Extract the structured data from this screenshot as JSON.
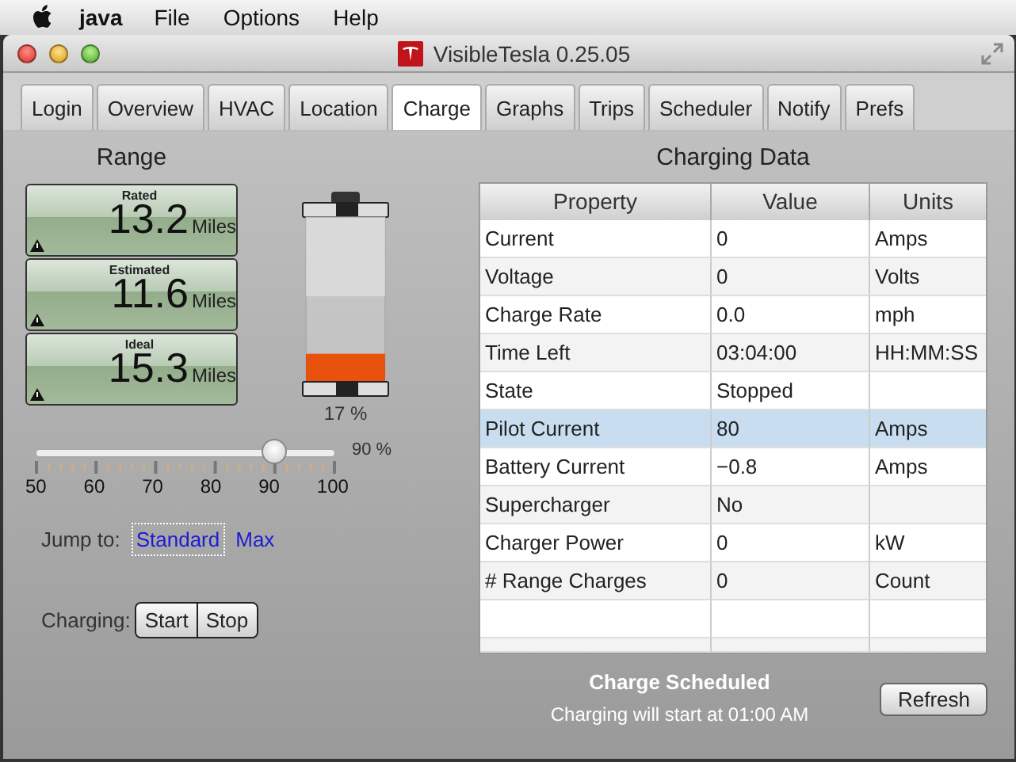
{
  "menubar": {
    "app": "java",
    "items": [
      "File",
      "Options",
      "Help"
    ]
  },
  "window": {
    "title": "VisibleTesla 0.25.05"
  },
  "tabs": [
    {
      "label": "Login",
      "selected": false
    },
    {
      "label": "Overview",
      "selected": false
    },
    {
      "label": "HVAC",
      "selected": false
    },
    {
      "label": "Location",
      "selected": false
    },
    {
      "label": "Charge",
      "selected": true
    },
    {
      "label": "Graphs",
      "selected": false
    },
    {
      "label": "Trips",
      "selected": false
    },
    {
      "label": "Scheduler",
      "selected": false
    },
    {
      "label": "Notify",
      "selected": false
    },
    {
      "label": "Prefs",
      "selected": false
    }
  ],
  "range": {
    "title": "Range",
    "gauges": [
      {
        "label": "Rated",
        "value": "13.2",
        "unit": "Miles",
        "warning": true
      },
      {
        "label": "Estimated",
        "value": "11.6",
        "unit": "Miles",
        "warning": true
      },
      {
        "label": "Ideal",
        "value": "15.3",
        "unit": "Miles",
        "warning": true
      }
    ]
  },
  "battery": {
    "level": 0.17,
    "reading": "17  %"
  },
  "charge_limit": {
    "level": 0.8,
    "reading": "90 %",
    "ticks": [
      "50",
      "60",
      "70",
      "80",
      "90",
      "100"
    ]
  },
  "jump_to": {
    "label": "Jump to:",
    "links": [
      {
        "label": "Standard",
        "focused": true
      },
      {
        "label": "Max",
        "focused": false
      }
    ]
  },
  "charging": {
    "label": "Charging:",
    "buttons": [
      "Start",
      "Stop"
    ]
  },
  "charging_data": {
    "title": "Charging Data",
    "columns": [
      "Property",
      "Value",
      "Units"
    ],
    "rows": [
      {
        "cells": [
          "Current",
          "0",
          "Amps"
        ],
        "selected": false
      },
      {
        "cells": [
          "Voltage",
          "0",
          "Volts"
        ],
        "selected": false
      },
      {
        "cells": [
          "Charge Rate",
          "0.0",
          "mph"
        ],
        "selected": false
      },
      {
        "cells": [
          "Time Left",
          "03:04:00",
          "HH:MM:SS"
        ],
        "selected": false
      },
      {
        "cells": [
          "State",
          "Stopped"
        ],
        "selected": false
      },
      {
        "cells": [
          "Pilot Current",
          "80",
          "Amps"
        ],
        "selected": true
      },
      {
        "cells": [
          "Battery Current",
          "−0.8",
          "Amps"
        ],
        "selected": false
      },
      {
        "cells": [
          "Supercharger",
          "No"
        ],
        "selected": false
      },
      {
        "cells": [
          "Charger Power",
          "0",
          "kW"
        ],
        "selected": false
      },
      {
        "cells": [
          "# Range Charges",
          "0",
          "Count"
        ],
        "selected": false
      }
    ]
  },
  "status": {
    "title": "Charge Scheduled",
    "message": "Charging will start at 01:00 AM"
  },
  "refresh_button": "Refresh"
}
